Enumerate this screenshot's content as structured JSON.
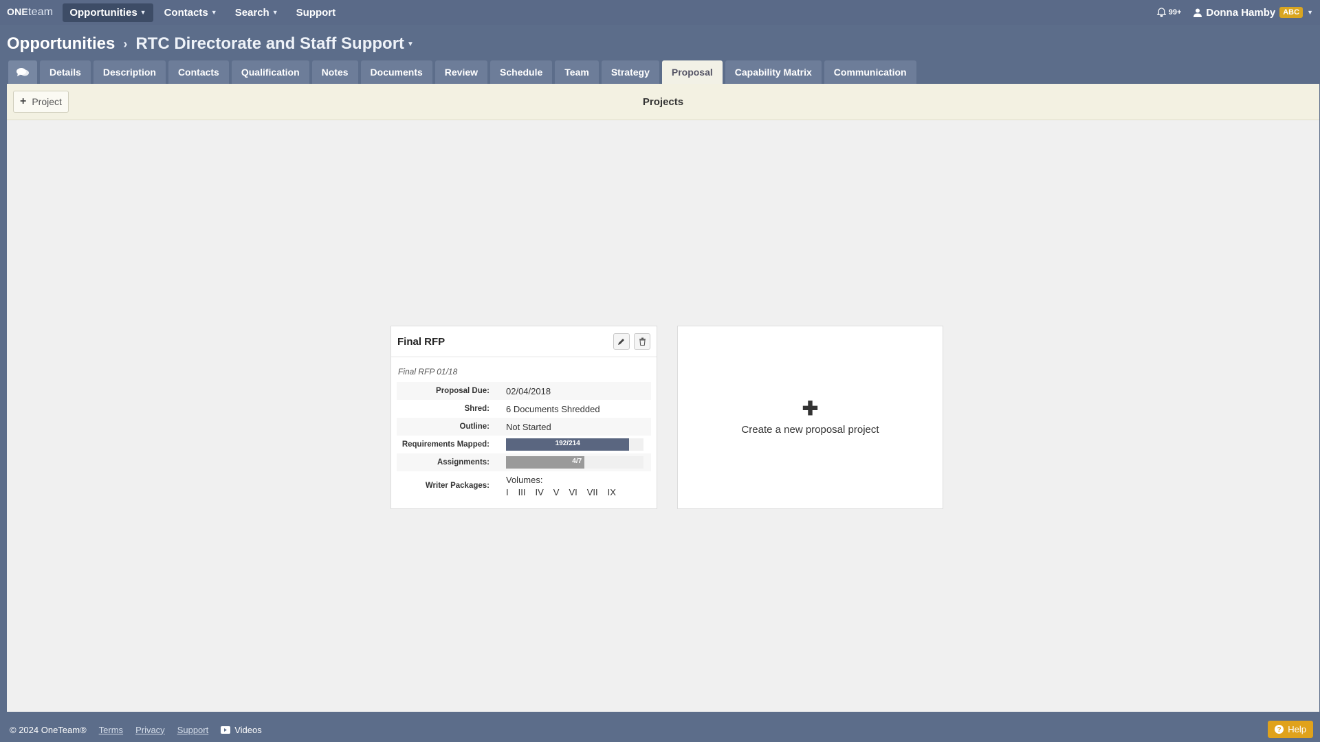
{
  "brand": {
    "one": "ONE",
    "team": "team"
  },
  "nav": {
    "items": [
      {
        "label": "Opportunities",
        "has_caret": true,
        "active": true
      },
      {
        "label": "Contacts",
        "has_caret": true
      },
      {
        "label": "Search",
        "has_caret": true
      },
      {
        "label": "Support",
        "has_caret": false
      }
    ]
  },
  "notifications": {
    "count": "99+"
  },
  "user": {
    "name": "Donna Hamby",
    "badge": "ABC"
  },
  "breadcrumb": {
    "root": "Opportunities",
    "current": "RTC Directorate and Staff Support"
  },
  "tabs": [
    "Details",
    "Description",
    "Contacts",
    "Qualification",
    "Notes",
    "Documents",
    "Review",
    "Schedule",
    "Team",
    "Strategy",
    "Proposal",
    "Capability Matrix",
    "Communication"
  ],
  "active_tab": "Proposal",
  "toolbar": {
    "add_label": "Project",
    "title": "Projects"
  },
  "project": {
    "title": "Final RFP",
    "subtitle": "Final RFP 01/18",
    "fields": {
      "proposal_due_label": "Proposal Due:",
      "proposal_due": "02/04/2018",
      "shred_label": "Shred:",
      "shred": "6 Documents Shredded",
      "outline_label": "Outline:",
      "outline": "Not Started",
      "requirements_label": "Requirements Mapped:",
      "requirements_text": "192/214",
      "requirements_fraction": 0.897,
      "assignments_label": "Assignments:",
      "assignments_text": "4/7",
      "assignments_fraction": 0.571,
      "writer_packages_label": "Writer Packages:",
      "volumes_label": "Volumes:",
      "volumes": [
        "I",
        "III",
        "IV",
        "V",
        "VI",
        "VII",
        "IX"
      ]
    }
  },
  "create_card": {
    "label": "Create a new proposal project"
  },
  "footer": {
    "copyright": "© 2024 OneTeam®",
    "links": [
      "Terms",
      "Privacy",
      "Support"
    ],
    "videos": "Videos",
    "help": "Help"
  },
  "colors": {
    "topbar": "#5a6a88",
    "requirements_bar": "#5a6680",
    "assignments_bar": "#9a9a9a",
    "help": "#e0a21b"
  },
  "icons": [
    "bell-icon",
    "user-icon",
    "chat-icon",
    "plus-icon",
    "pencil-icon",
    "trash-icon",
    "video-icon",
    "question-icon"
  ]
}
